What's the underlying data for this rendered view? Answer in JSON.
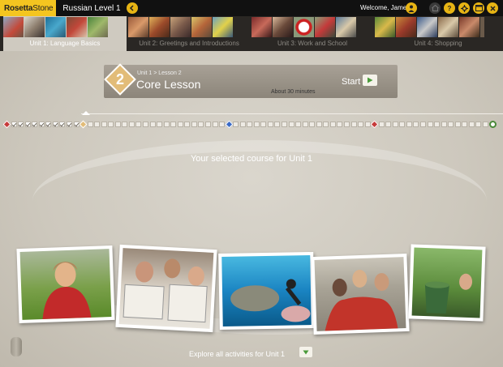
{
  "app": {
    "logo_bold": "Rosetta",
    "logo_light": "Stone",
    "course": "Russian Level 1",
    "welcome": "Welcome, James"
  },
  "units": [
    {
      "label": "Unit 1: Language Basics",
      "active": true
    },
    {
      "label": "Unit 2: Greetings and Introductions",
      "active": false
    },
    {
      "label": "Unit 3: Work and School",
      "active": false
    },
    {
      "label": "Unit 4: Shopping",
      "active": false
    }
  ],
  "lesson": {
    "number": "2",
    "path": "Unit 1 > Lesson 2",
    "title": "Core Lesson",
    "duration": "About 30 minutes",
    "start_label": "Start"
  },
  "progress": {
    "completed": 11,
    "total": 70
  },
  "selected_text": "Your selected course for Unit 1",
  "explore_text": "Explore all activities for Unit 1",
  "colors": {
    "brand": "#f4c520",
    "accent_green": "#4a9a3a"
  },
  "icons": [
    "back-icon",
    "user-icon",
    "home-icon",
    "help-icon",
    "settings-icon",
    "window-icon",
    "close-icon",
    "play-icon",
    "chevron-down-icon",
    "microphone-icon"
  ]
}
